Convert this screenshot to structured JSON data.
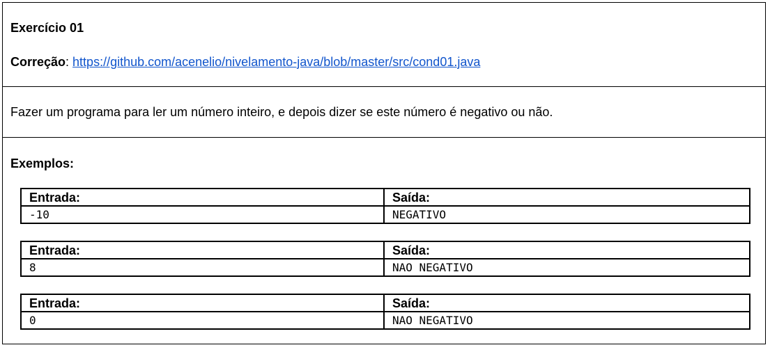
{
  "header": {
    "title": "Exercício 01",
    "correction_label": "Correção",
    "correction_sep": ": ",
    "correction_link": "https://github.com/acenelio/nivelamento-java/blob/master/src/cond01.java"
  },
  "description": "Fazer um programa para ler um número inteiro, e depois dizer se este número é negativo ou não.",
  "examples": {
    "title": "Exemplos:",
    "input_header": "Entrada:",
    "output_header": "Saída:",
    "items": [
      {
        "input": "-10",
        "output": "NEGATIVO"
      },
      {
        "input": "8",
        "output": "NAO NEGATIVO"
      },
      {
        "input": "0",
        "output": "NAO NEGATIVO"
      }
    ]
  }
}
